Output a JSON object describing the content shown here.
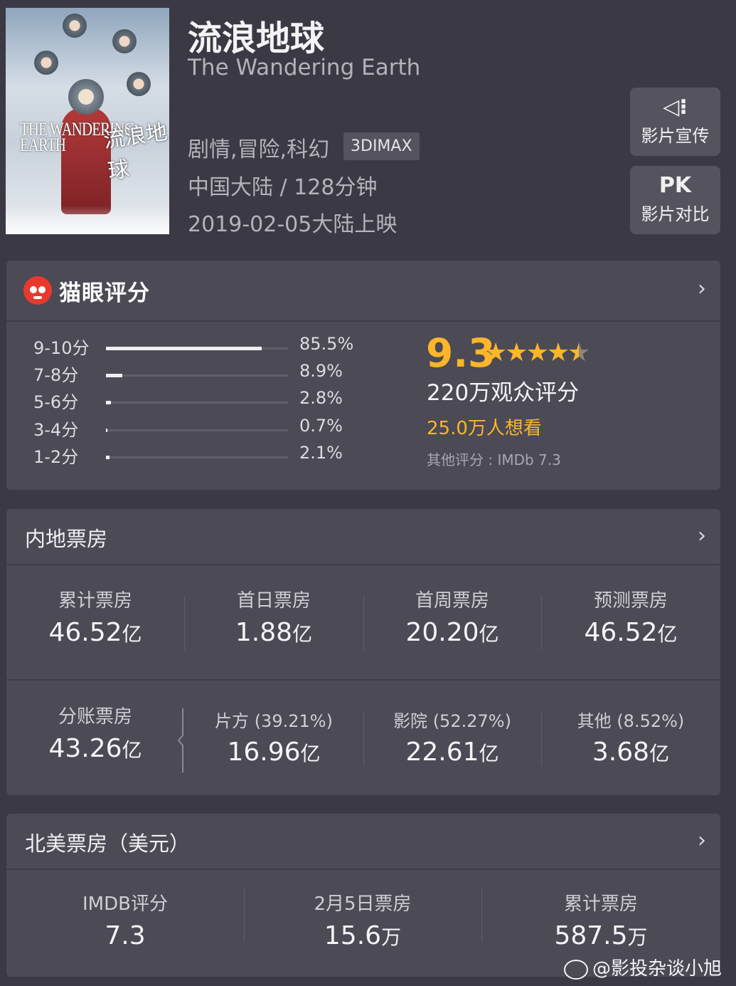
{
  "movie": {
    "title_cn": "流浪地球",
    "title_en": "The Wandering Earth",
    "genre": "剧情,冒险,科幻",
    "format_tag": "3DIMAX",
    "region_duration": "中国大陆 / 128分钟",
    "release": "2019-02-05大陆上映",
    "poster_text_en": "THE WANDERING EARTH",
    "poster_text_cn": "流浪地球"
  },
  "side_buttons": [
    {
      "icon": "speaker-icon",
      "icon_text": "◁⁝",
      "label": "影片宣传"
    },
    {
      "icon": "pk-icon",
      "icon_text": "PK",
      "label": "影片对比"
    }
  ],
  "rating": {
    "brand": "猫眼评分",
    "chevron": "›",
    "distribution": [
      {
        "label": "9-10分",
        "pct": "85.5%",
        "value": 85.5
      },
      {
        "label": "7-8分",
        "pct": "8.9%",
        "value": 8.9
      },
      {
        "label": "5-6分",
        "pct": "2.8%",
        "value": 2.8
      },
      {
        "label": "3-4分",
        "pct": "0.7%",
        "value": 0.7
      },
      {
        "label": "1-2分",
        "pct": "2.1%",
        "value": 2.1
      }
    ],
    "score": "9.3",
    "stars": 4.5,
    "audience": "220万观众评分",
    "want": "25.0万人想看",
    "other": "其他评分 : IMDb 7.3",
    "accent": "#fdb52a"
  },
  "mainland": {
    "title": "内地票房",
    "chevron": "›",
    "stats": [
      {
        "key": "累计票房",
        "num": "46.52",
        "unit": "亿"
      },
      {
        "key": "首日票房",
        "num": "1.88",
        "unit": "亿"
      },
      {
        "key": "首周票房",
        "num": "20.20",
        "unit": "亿"
      },
      {
        "key": "预测票房",
        "num": "46.52",
        "unit": "亿"
      }
    ],
    "split": [
      {
        "key": "分账票房",
        "num": "43.26",
        "unit": "亿"
      },
      {
        "key": "片方 (39.21%)",
        "num": "16.96",
        "unit": "亿"
      },
      {
        "key": "影院 (52.27%)",
        "num": "22.61",
        "unit": "亿"
      },
      {
        "key": "其他 (8.52%)",
        "num": "3.68",
        "unit": "亿"
      }
    ]
  },
  "northamerica": {
    "title": "北美票房（美元）",
    "chevron": "›",
    "stats": [
      {
        "key": "IMDB评分",
        "num": "7.3",
        "unit": ""
      },
      {
        "key": "2月5日票房",
        "num": "15.6",
        "unit": "万"
      },
      {
        "key": "累计票房",
        "num": "587.5",
        "unit": "万"
      }
    ]
  },
  "watermark": "@影投杂谈小旭"
}
